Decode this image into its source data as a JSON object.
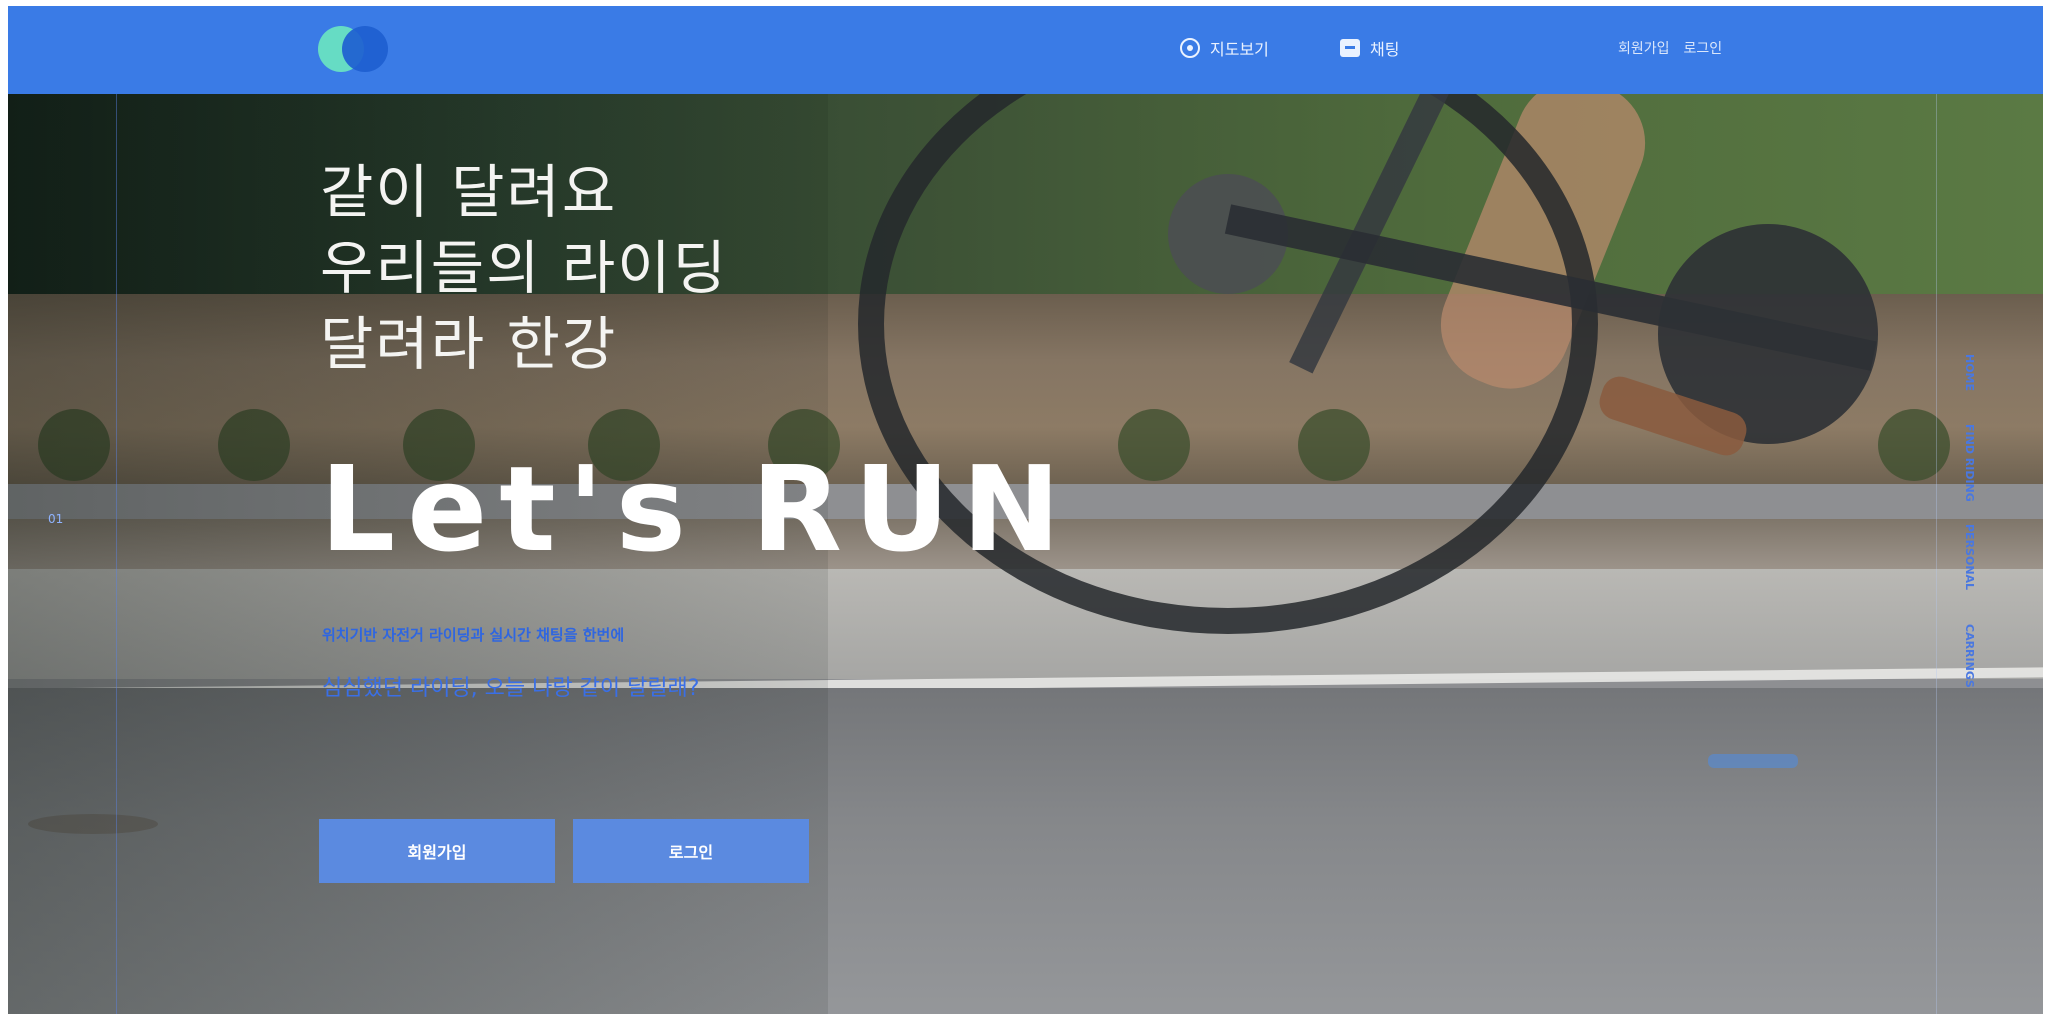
{
  "header": {
    "nav": [
      {
        "label": "지도보기",
        "icon": "map-icon"
      },
      {
        "label": "채팅",
        "icon": "chat-icon"
      }
    ],
    "auth": {
      "signup_label": "회원가입",
      "login_label": "로그인"
    },
    "colors": {
      "bar": "#3a7be6",
      "logo_teal": "#66dcc4",
      "logo_blue": "#1e5ed0"
    }
  },
  "hero": {
    "headline_lines": [
      "같이 달려요",
      "우리들의 라이딩",
      "달려라 한강"
    ],
    "big_title": "Let's RUN",
    "subtitle": "위치기반 자전거 라이딩과 실시간 채팅을 한번에",
    "tagline": "심심했던 라이딩, 오늘 나랑 같이 달릴래?",
    "buttons": {
      "signup": "회원가입",
      "login": "로그인"
    },
    "guide_label": "01"
  },
  "side_nav": [
    "HOME",
    "FIND RIDING",
    "PERSONAL",
    "CARRINGS"
  ]
}
